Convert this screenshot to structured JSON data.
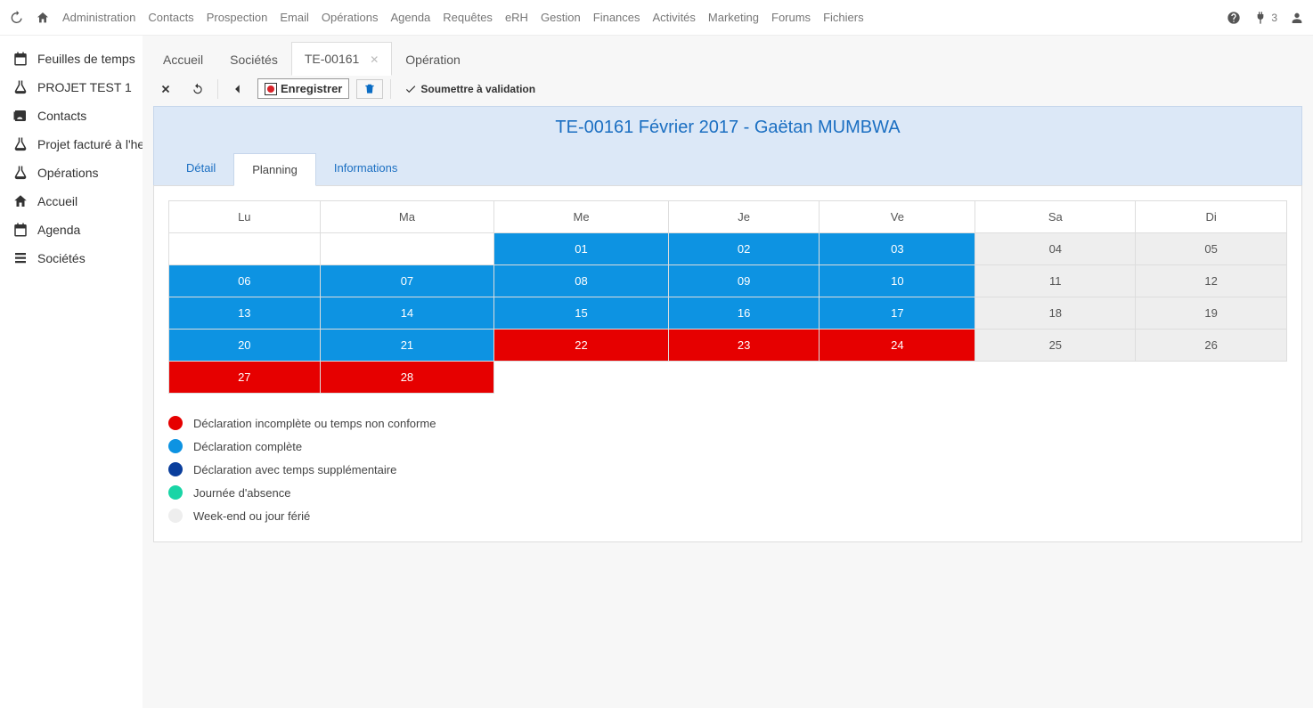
{
  "top_menu": [
    "Administration",
    "Contacts",
    "Prospection",
    "Email",
    "Opérations",
    "Agenda",
    "Requêtes",
    "eRH",
    "Gestion",
    "Finances",
    "Activités",
    "Marketing",
    "Forums",
    "Fichiers"
  ],
  "top_right": {
    "notif_count": "3"
  },
  "sidebar": {
    "items": [
      {
        "icon": "calendar",
        "label": "Feuilles de temps"
      },
      {
        "icon": "flask",
        "label": "PROJET TEST 1"
      },
      {
        "icon": "contacts",
        "label": "Contacts"
      },
      {
        "icon": "flask",
        "label": "Projet facturé à l'heu"
      },
      {
        "icon": "flask",
        "label": "Opérations"
      },
      {
        "icon": "home",
        "label": "Accueil"
      },
      {
        "icon": "calendar",
        "label": "Agenda"
      },
      {
        "icon": "list",
        "label": "Sociétés"
      }
    ]
  },
  "tabs": [
    {
      "label": "Accueil",
      "active": false,
      "closable": false
    },
    {
      "label": "Sociétés",
      "active": false,
      "closable": false
    },
    {
      "label": "TE-00161",
      "active": true,
      "closable": true
    },
    {
      "label": "Opération",
      "active": false,
      "closable": false
    }
  ],
  "toolbar": {
    "save_label": "Enregistrer",
    "submit_label": "Soumettre à validation"
  },
  "page": {
    "title": "TE-00161 Février 2017 - Gaëtan MUMBWA"
  },
  "sub_tabs": [
    "Détail",
    "Planning",
    "Informations"
  ],
  "sub_active": 1,
  "calendar": {
    "headers": [
      "Lu",
      "Ma",
      "Me",
      "Je",
      "Ve",
      "Sa",
      "Di"
    ],
    "rows": [
      [
        {
          "label": "",
          "cls": "empty"
        },
        {
          "label": "",
          "cls": "empty"
        },
        {
          "label": "01",
          "cls": "blue"
        },
        {
          "label": "02",
          "cls": "blue"
        },
        {
          "label": "03",
          "cls": "blue"
        },
        {
          "label": "04",
          "cls": "grey"
        },
        {
          "label": "05",
          "cls": "grey"
        }
      ],
      [
        {
          "label": "06",
          "cls": "blue"
        },
        {
          "label": "07",
          "cls": "blue"
        },
        {
          "label": "08",
          "cls": "blue"
        },
        {
          "label": "09",
          "cls": "blue"
        },
        {
          "label": "10",
          "cls": "blue"
        },
        {
          "label": "11",
          "cls": "grey"
        },
        {
          "label": "12",
          "cls": "grey"
        }
      ],
      [
        {
          "label": "13",
          "cls": "blue"
        },
        {
          "label": "14",
          "cls": "blue"
        },
        {
          "label": "15",
          "cls": "blue"
        },
        {
          "label": "16",
          "cls": "blue"
        },
        {
          "label": "17",
          "cls": "blue"
        },
        {
          "label": "18",
          "cls": "grey"
        },
        {
          "label": "19",
          "cls": "grey"
        }
      ],
      [
        {
          "label": "20",
          "cls": "blue"
        },
        {
          "label": "21",
          "cls": "blue"
        },
        {
          "label": "22",
          "cls": "red"
        },
        {
          "label": "23",
          "cls": "red"
        },
        {
          "label": "24",
          "cls": "red"
        },
        {
          "label": "25",
          "cls": "grey"
        },
        {
          "label": "26",
          "cls": "grey"
        }
      ],
      [
        {
          "label": "27",
          "cls": "red"
        },
        {
          "label": "28",
          "cls": "red"
        },
        {
          "label": "",
          "cls": "none"
        },
        {
          "label": "",
          "cls": "none"
        },
        {
          "label": "",
          "cls": "none"
        },
        {
          "label": "",
          "cls": "none"
        },
        {
          "label": "",
          "cls": "none"
        }
      ]
    ]
  },
  "legend": [
    {
      "color": "red",
      "label": "Déclaration incomplète ou temps non conforme"
    },
    {
      "color": "blue",
      "label": "Déclaration complète"
    },
    {
      "color": "dark",
      "label": "Déclaration avec temps supplémentaire"
    },
    {
      "color": "teal",
      "label": "Journée d'absence"
    },
    {
      "color": "grey",
      "label": "Week-end ou jour férié"
    }
  ]
}
